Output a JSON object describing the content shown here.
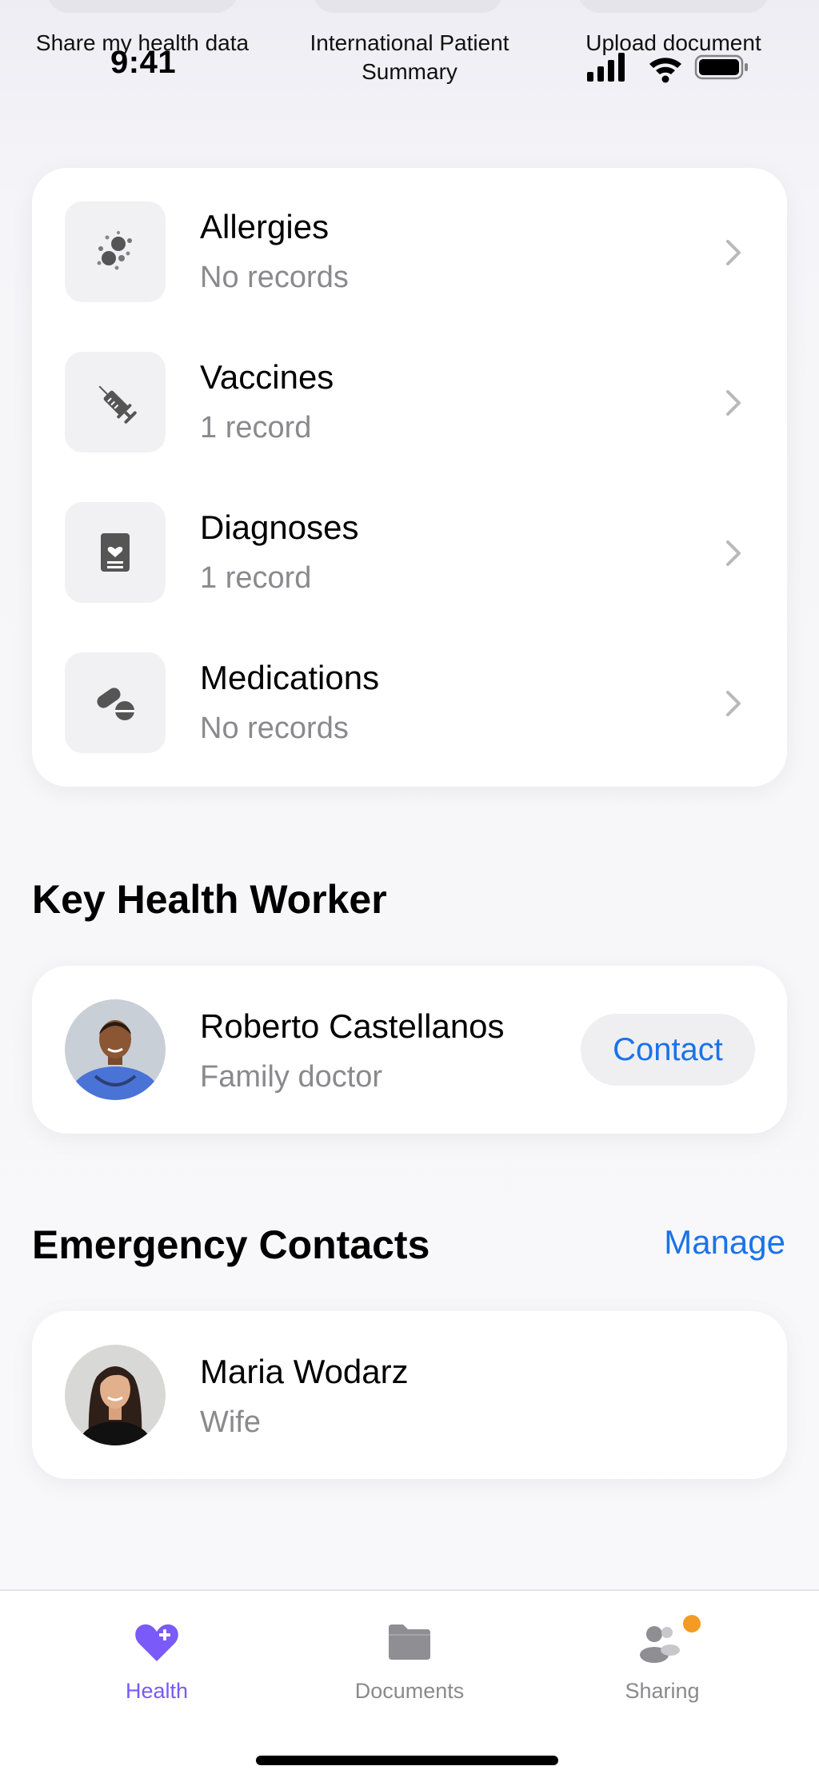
{
  "status_bar": {
    "time": "9:41"
  },
  "quick_actions": [
    {
      "label": "Share my health data"
    },
    {
      "label": "International Patient Summary"
    },
    {
      "label": "Upload document"
    }
  ],
  "records": [
    {
      "title": "Allergies",
      "subtitle": "No records",
      "icon": "allergen-icon"
    },
    {
      "title": "Vaccines",
      "subtitle": "1 record",
      "icon": "syringe-icon"
    },
    {
      "title": "Diagnoses",
      "subtitle": "1 record",
      "icon": "medical-report-icon"
    },
    {
      "title": "Medications",
      "subtitle": "No records",
      "icon": "pills-icon"
    }
  ],
  "key_health_worker": {
    "heading": "Key Health Worker",
    "name": "Roberto Castellanos",
    "role": "Family doctor",
    "contact_label": "Contact"
  },
  "emergency_contacts": {
    "heading": "Emergency Contacts",
    "manage_label": "Manage",
    "contacts": [
      {
        "name": "Maria Wodarz",
        "relation": "Wife"
      }
    ]
  },
  "tab_bar": {
    "tabs": [
      {
        "label": "Health",
        "icon": "heart-plus-icon",
        "active": true
      },
      {
        "label": "Documents",
        "icon": "folder-icon",
        "active": false
      },
      {
        "label": "Sharing",
        "icon": "people-icon",
        "active": false,
        "badge": true
      }
    ]
  },
  "colors": {
    "accent_purple": "#7a5af8",
    "link_blue": "#1a73e8",
    "badge_orange": "#f59a23",
    "secondary_text": "#8a8a8e"
  }
}
